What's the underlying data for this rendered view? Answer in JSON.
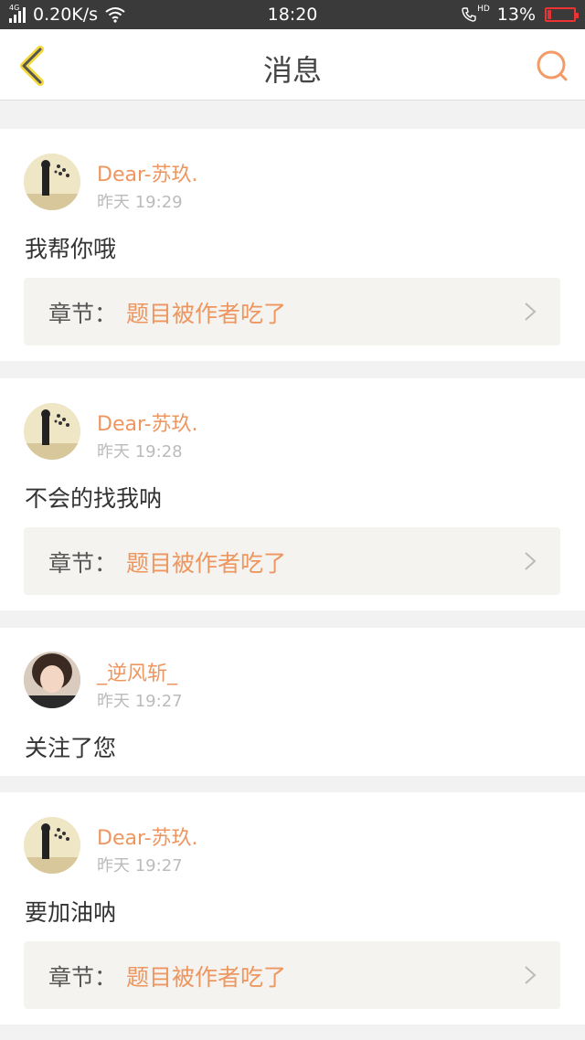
{
  "status_bar": {
    "network": "4G",
    "speed": "0.20K/s",
    "time": "18:20",
    "call_hd": "HD",
    "battery_pct": "13%",
    "battery_level": 0.13,
    "battery_color": "#e33333"
  },
  "header": {
    "title": "消息"
  },
  "colors": {
    "accent": "#ee9660",
    "chapter_bg": "#f4f3ef"
  },
  "messages": [
    {
      "user": "Dear-苏玖.",
      "time": "昨天 19:29",
      "text": "我帮你哦",
      "chapter_label": "章节：",
      "chapter_title": "题目被作者吃了"
    },
    {
      "user": "Dear-苏玖.",
      "time": "昨天 19:28",
      "text": "不会的找我呐",
      "chapter_label": "章节：",
      "chapter_title": "题目被作者吃了"
    },
    {
      "user": "_逆风斩_",
      "time": "昨天 19:27",
      "text": "关注了您"
    },
    {
      "user": "Dear-苏玖.",
      "time": "昨天 19:27",
      "text": "要加油呐",
      "chapter_label": "章节：",
      "chapter_title": "题目被作者吃了"
    }
  ]
}
